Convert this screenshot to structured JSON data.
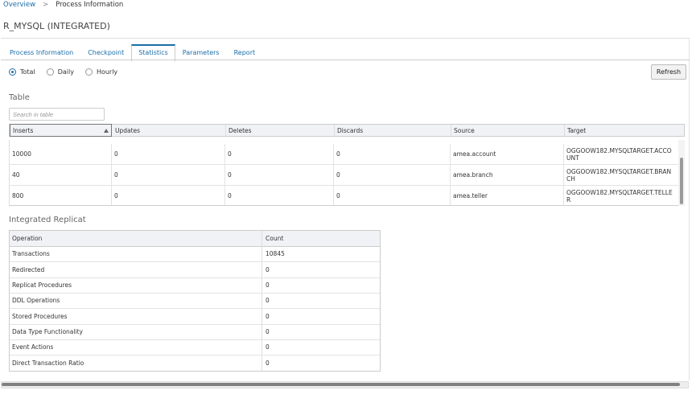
{
  "breadcrumb": {
    "overview": "Overview",
    "separator": ">",
    "current": "Process Information"
  },
  "page_title": "R_MYSQL (INTEGRATED)",
  "tabs": [
    {
      "label": "Process Information",
      "active": false
    },
    {
      "label": "Checkpoint",
      "active": false
    },
    {
      "label": "Statistics",
      "active": true
    },
    {
      "label": "Parameters",
      "active": false
    },
    {
      "label": "Report",
      "active": false
    }
  ],
  "radios": [
    {
      "label": "Total",
      "selected": true
    },
    {
      "label": "Daily",
      "selected": false
    },
    {
      "label": "Hourly",
      "selected": false
    }
  ],
  "refresh_label": "Refresh",
  "table_section": {
    "title": "Table",
    "search_placeholder": "Search in table",
    "columns": [
      "Inserts",
      "Updates",
      "Deletes",
      "Discards",
      "Source",
      "Target"
    ],
    "sort_column": "Inserts",
    "sort_direction": "ascending",
    "rows": [
      [
        "10000",
        "0",
        "0",
        "0",
        "amea.account",
        "OGGOOW182.MYSQLTARGET.ACCOUNT"
      ],
      [
        "40",
        "0",
        "0",
        "0",
        "amea.branch",
        "OGGOOW182.MYSQLTARGET.BRANCH"
      ],
      [
        "800",
        "0",
        "0",
        "0",
        "amea.teller",
        "OGGOOW182.MYSQLTARGET.TELLER"
      ]
    ]
  },
  "replicat_section": {
    "title": "Integrated Replicat",
    "columns": [
      "Operation",
      "Count"
    ],
    "rows": [
      [
        "Transactions",
        "10845"
      ],
      [
        "Redirected",
        "0"
      ],
      [
        "Replicat Procedures",
        "0"
      ],
      [
        "DDL Operations",
        "0"
      ],
      [
        "Stored Procedures",
        "0"
      ],
      [
        "Data Type Functionality",
        "0"
      ],
      [
        "Event Actions",
        "0"
      ],
      [
        "Direct Transaction Ratio",
        "0"
      ]
    ]
  },
  "colors": {
    "link": "#1a6ea8",
    "header_bg": "#f0f2f5",
    "border": "#cccccc"
  }
}
